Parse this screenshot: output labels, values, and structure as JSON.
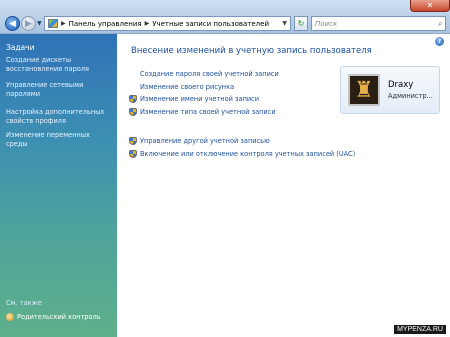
{
  "address_bar": {
    "crumbs": [
      "Панель управления",
      "Учетные записи пользователей"
    ],
    "search_placeholder": "Поиск"
  },
  "sidebar": {
    "title": "Задачи",
    "links": [
      "Создание дискеты восстановления пароля",
      "Управление сетевыми паролями",
      "Настройка дополнительных свойств профиля",
      "Изменение переменных среды"
    ],
    "see_also": "См. также",
    "parental_control": "Родительский контроль"
  },
  "main": {
    "title": "Внесение изменений в учетную запись пользователя",
    "tasks_group1": [
      {
        "label": "Создание пароля своей учетной записи",
        "shield": false
      },
      {
        "label": "Изменение своего рисунка",
        "shield": false
      },
      {
        "label": "Изменение имени учетной записи",
        "shield": true
      },
      {
        "label": "Изменение типа своей учетной записи",
        "shield": true
      }
    ],
    "tasks_group2": [
      {
        "label": "Управление другой учетной записью",
        "shield": true
      },
      {
        "label": "Включение или отключение контроля учетных записей (UAC)",
        "shield": true
      }
    ],
    "user": {
      "name": "Draxy",
      "role": "Администр..."
    }
  },
  "watermark": "MYPENZA.RU",
  "icons": {
    "back": "back-arrow-icon",
    "forward": "forward-arrow-icon",
    "refresh": "refresh-icon",
    "search": "search-icon",
    "help": "help-icon",
    "shield": "uac-shield-icon",
    "avatar": "chess-pieces-avatar"
  },
  "colors": {
    "link": "#1c4f9d",
    "title": "#1b4f9c",
    "sidebar_top": "#2f72b8",
    "sidebar_bottom": "#5eb08a"
  }
}
